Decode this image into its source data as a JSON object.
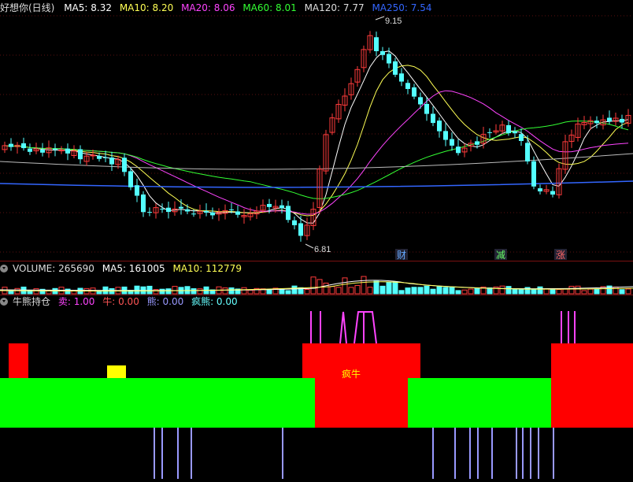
{
  "main": {
    "title": "好想你(日线)",
    "ma": [
      {
        "label": "MA5: 8.32",
        "color": "#ffffff"
      },
      {
        "label": "MA10: 8.20",
        "color": "#ffff55"
      },
      {
        "label": "MA20: 8.06",
        "color": "#ff44ff"
      },
      {
        "label": "MA60: 8.01",
        "color": "#33ff33"
      },
      {
        "label": "MA120: 7.77",
        "color": "#dddddd"
      },
      {
        "label": "MA250: 7.54",
        "color": "#3366ff"
      }
    ],
    "high_label": "9.15",
    "low_label": "6.81",
    "event_labels": [
      "财",
      "减",
      "涨"
    ]
  },
  "volume": {
    "title": "VOLUME: 265690",
    "ma5": "MA5: 161005",
    "ma10": "MA10: 112779"
  },
  "indicator": {
    "title": "牛熊持仓",
    "sell": "卖: 1.00",
    "bull": "牛: 0.00",
    "bear": "熊: 0.00",
    "crazy_bear": "疯熊: 0.00",
    "crazy_bull_label": "疯牛"
  },
  "colors": {
    "up": "#ff3b3b",
    "down": "#54ffff",
    "bull": "#ff0000",
    "bear": "#00ff00",
    "marker": "#ffff00",
    "sell_spike": "#ff44ff",
    "buy_spike": "#9999ff"
  }
}
